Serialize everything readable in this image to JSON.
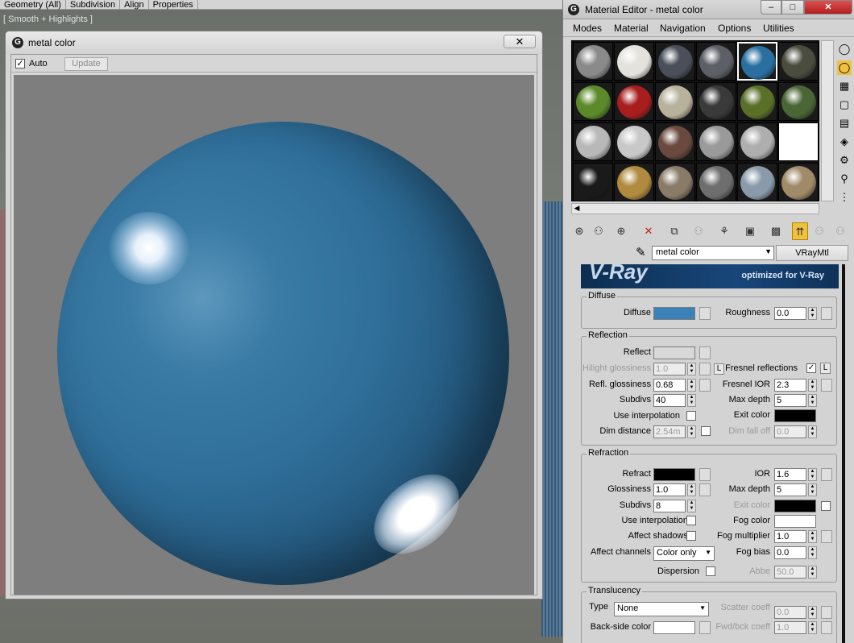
{
  "viewport": {
    "menu": [
      "Geometry (All)",
      "Subdivision",
      "Align",
      "Properties"
    ],
    "shading_label": "[ Smooth + Highlights ]"
  },
  "preview_window": {
    "title": "metal color",
    "close_glyph": "✕",
    "auto_label": "Auto",
    "auto_checked": true,
    "update_label": "Update",
    "sphere_color": "#2f6f9a"
  },
  "material_editor": {
    "title": "Material Editor - metal color",
    "menus": [
      "Modes",
      "Material",
      "Navigation",
      "Options",
      "Utilities"
    ],
    "slots": [
      [
        "#8a8a8a",
        "#e4e2dc",
        "#4a4f59",
        "#5c6066",
        "#2a6fa0",
        "#4a4d3e"
      ],
      [
        "#5c8a2a",
        "#a81e1e",
        "#b8b29c",
        "#3a3a3a",
        "#5a7028",
        "#4a6636"
      ],
      [
        "#b8b8b8",
        "#c8c8c8",
        "#6a4a3e",
        "#9a9a9a",
        "#aeaeae",
        "#ffffff"
      ],
      [
        "#1a1a1a",
        "#b08a3e",
        "#8a7a68",
        "#6e6e6e",
        "#8a9aaa",
        "#a08a68"
      ]
    ],
    "selected_slot": "0-4",
    "material_name": "metal color",
    "material_type": "VRayMtl",
    "banner_tagline": "optimized for V-Ray",
    "banner_logo": "V-Ray",
    "diffuse": {
      "section": "Diffuse",
      "diffuse_label": "Diffuse",
      "diffuse_color": "#3a82b8",
      "roughness_label": "Roughness",
      "roughness": "0.0"
    },
    "reflection": {
      "section": "Reflection",
      "reflect_label": "Reflect",
      "reflect_color": "#d8d8d8",
      "hilight_label": "Hilight glossiness",
      "hilight": "1.0",
      "l_label": "L",
      "fresnel_label": "Fresnel reflections",
      "fresnel_checked": true,
      "refl_gloss_label": "Refl. glossiness",
      "refl_gloss": "0.68",
      "fresnel_ior_label": "Fresnel IOR",
      "fresnel_ior": "2.3",
      "subdivs_label": "Subdivs",
      "subdivs": "40",
      "max_depth_label": "Max depth",
      "max_depth": "5",
      "use_interp_label": "Use interpolation",
      "exit_color_label": "Exit color",
      "exit_color": "#000000",
      "dim_distance_label": "Dim distance",
      "dim_distance": "2.54m",
      "dim_falloff_label": "Dim fall off",
      "dim_falloff": "0.0"
    },
    "refraction": {
      "section": "Refraction",
      "refract_label": "Refract",
      "refract_color": "#000000",
      "ior_label": "IOR",
      "ior": "1.6",
      "glossiness_label": "Glossiness",
      "glossiness": "1.0",
      "max_depth_label": "Max depth",
      "max_depth": "5",
      "subdivs_label": "Subdivs",
      "subdivs": "8",
      "exit_color_label": "Exit color",
      "exit_color": "#000000",
      "use_interp_label": "Use interpolation",
      "fog_color_label": "Fog color",
      "fog_color": "#ffffff",
      "affect_shadows_label": "Affect shadows",
      "fog_mult_label": "Fog multiplier",
      "fog_mult": "1.0",
      "affect_channels_label": "Affect channels",
      "affect_channels": "Color only",
      "fog_bias_label": "Fog bias",
      "fog_bias": "0.0",
      "dispersion_label": "Dispersion",
      "abbe_label": "Abbe",
      "abbe": "50.0"
    },
    "translucency": {
      "section": "Translucency",
      "type_label": "Type",
      "type": "None",
      "scatter_label": "Scatter coeff",
      "scatter": "0.0",
      "backside_label": "Back-side color",
      "backside_color": "#ffffff",
      "fwdbck_label": "Fwd/bck coeff",
      "fwdbck": "1.0"
    }
  }
}
